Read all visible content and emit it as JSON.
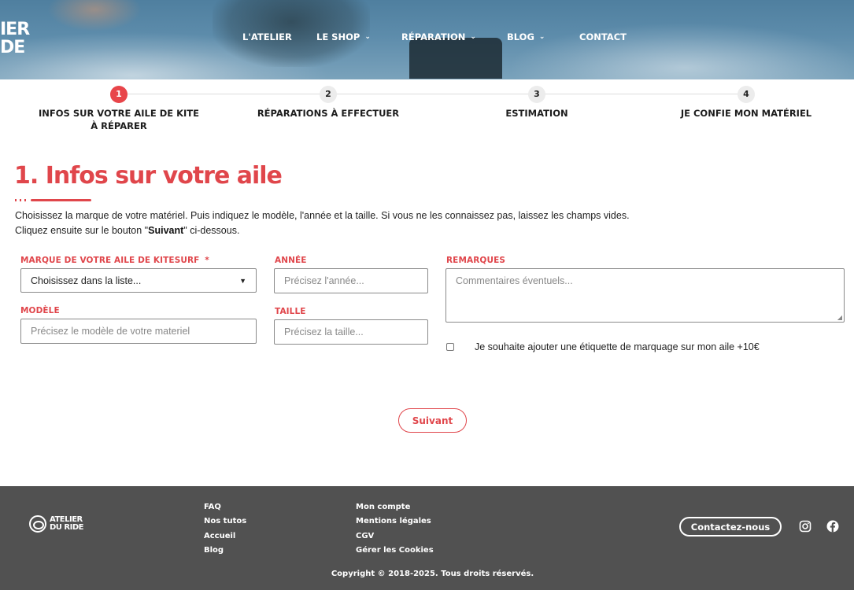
{
  "header": {
    "logo_lines": [
      "IER",
      "DE"
    ],
    "nav": [
      {
        "label": "L'ATELIER",
        "has_dropdown": false
      },
      {
        "label": "LE SHOP",
        "has_dropdown": true
      },
      {
        "label": "RÉPARATION",
        "has_dropdown": true
      },
      {
        "label": "BLOG",
        "has_dropdown": true
      },
      {
        "label": "CONTACT",
        "has_dropdown": false
      }
    ]
  },
  "steps": [
    {
      "num": "1",
      "label": "INFOS SUR VOTRE AILE DE KITE À RÉPARER",
      "active": true
    },
    {
      "num": "2",
      "label": "RÉPARATIONS À EFFECTUER",
      "active": false
    },
    {
      "num": "3",
      "label": "ESTIMATION",
      "active": false
    },
    {
      "num": "4",
      "label": "JE CONFIE MON MATÉRIEL",
      "active": false
    }
  ],
  "main": {
    "title": "1. Infos sur votre aile",
    "intro_line1": "Choisissez la marque de votre matériel. Puis indiquez le modèle, l'année et la taille. Si vous ne les connaissez pas, laissez les champs vides.",
    "intro_line2_pre": "Cliquez ensuite sur le bouton \"",
    "intro_line2_bold": "Suivant",
    "intro_line2_post": "\" ci-dessous."
  },
  "form": {
    "brand_label": "MARQUE DE VOTRE AILE DE KITESURF",
    "brand_required": "*",
    "brand_value": "Choisissez dans la liste...",
    "model_label": "MODÈLE",
    "model_placeholder": "Précisez le modèle de votre materiel",
    "year_label": "ANNÉE",
    "year_placeholder": "Précisez l'année...",
    "size_label": "TAILLE",
    "size_placeholder": "Précisez la taille...",
    "remarks_label": "REMARQUES",
    "remarks_placeholder": "Commentaires éventuels...",
    "label_checkbox": "Je souhaite ajouter une étiquette de marquage sur mon aile +10€",
    "next_button": "Suivant"
  },
  "footer": {
    "logo_text_line1": "ATELIER",
    "logo_text_line2": "DU RIDE",
    "col1": [
      "FAQ",
      "Nos tutos",
      "Accueil",
      "Blog"
    ],
    "col2": [
      "Mon compte",
      "Mentions légales",
      "CGV",
      "Gérer les Cookies"
    ],
    "contact_button": "Contactez-nous",
    "copyright": "Copyright © 2018-2025. Tous droits réservés."
  },
  "colors": {
    "accent": "#e0464b",
    "footer_bg": "#515151"
  }
}
